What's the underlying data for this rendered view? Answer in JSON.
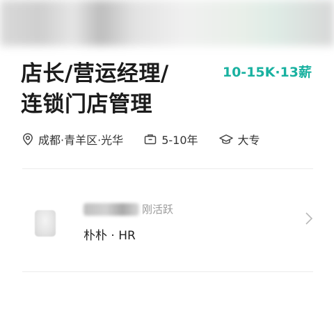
{
  "job": {
    "title_line1": "店长/营运经理/",
    "title_line2": "连锁门店管理",
    "salary": "10-15K·13薪"
  },
  "meta": {
    "location": "成都·青羊区·光华",
    "experience": "5-10年",
    "education": "大专"
  },
  "recruiter": {
    "status": "刚活跃",
    "role": "朴朴 · HR"
  },
  "icons": {
    "location": "location-pin-icon",
    "experience": "briefcase-icon",
    "education": "graduation-cap-icon",
    "chevron": "chevron-right-icon"
  },
  "colors": {
    "salary": "#19b1a0"
  }
}
